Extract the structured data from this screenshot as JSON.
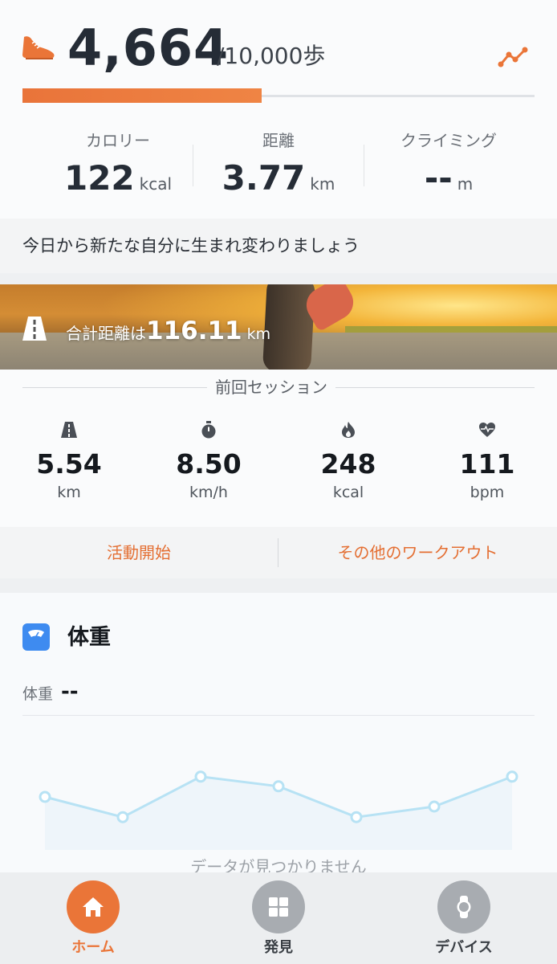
{
  "steps": {
    "value": "4,664",
    "goal": "/10,000歩",
    "progress": 0.4664
  },
  "stats": [
    {
      "label": "カロリー",
      "value": "122",
      "unit": "kcal"
    },
    {
      "label": "距離",
      "value": "3.77",
      "unit": "km"
    },
    {
      "label": "クライミング",
      "value": "--",
      "unit": "m"
    }
  ],
  "motto": "今日から新たな自分に生まれ変わりましょう",
  "banner": {
    "label": "合計距離は",
    "value": "116.11",
    "unit": "km"
  },
  "session": {
    "title": "前回セッション",
    "metrics": [
      {
        "icon": "road-icon",
        "value": "5.54",
        "unit": "km"
      },
      {
        "icon": "stopwatch-icon",
        "value": "8.50",
        "unit": "km/h"
      },
      {
        "icon": "flame-icon",
        "value": "248",
        "unit": "kcal"
      },
      {
        "icon": "heart-rate-icon",
        "value": "111",
        "unit": "bpm"
      }
    ]
  },
  "actions": {
    "start": "活動開始",
    "other": "その他のワークアウト"
  },
  "weight": {
    "title": "体重",
    "label": "体重",
    "value": "--",
    "nodata": "データが見つかりません"
  },
  "chart_data": {
    "type": "line",
    "series": [
      {
        "values": [
          55,
          34,
          76,
          66,
          34,
          45,
          76
        ]
      }
    ],
    "ylim": [
      0,
      100
    ],
    "grid": false
  },
  "tabs": [
    {
      "label": "ホーム",
      "icon": "home-icon",
      "active": true
    },
    {
      "label": "発見",
      "icon": "grid-icon",
      "active": false
    },
    {
      "label": "デバイス",
      "icon": "watch-icon",
      "active": false
    }
  ],
  "colors": {
    "accent": "#ea7538",
    "tabInactive": "#a8acb1",
    "chartLine": "#b7e2f4",
    "scaleIcon": "#3e8bf0"
  }
}
